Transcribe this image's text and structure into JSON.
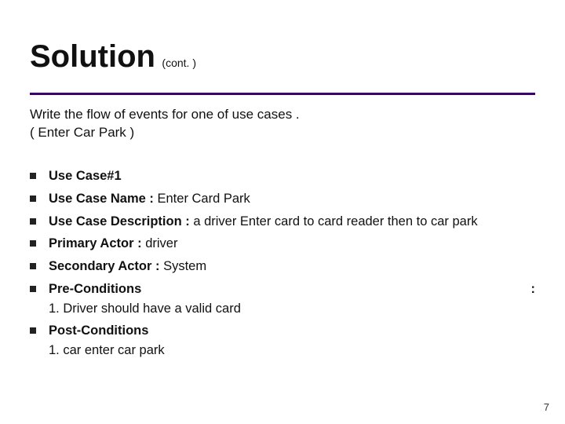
{
  "title": "Solution",
  "title_suffix": "(cont. )",
  "intro_line1": "Write the flow of events for one of use cases .",
  "intro_line2": "( Enter Car Park )",
  "items": {
    "i0": {
      "label": "Use Case#1",
      "value": ""
    },
    "i1": {
      "label": "Use Case Name : ",
      "value": "Enter Card Park"
    },
    "i2": {
      "label": "Use Case Description : ",
      "value": "a driver Enter card to card reader then to car park"
    },
    "i3": {
      "label": "Primary Actor : ",
      "value": "driver"
    },
    "i4": {
      "label": "Secondary Actor : ",
      "value": "System"
    },
    "i5": {
      "label": "Pre-Conditions",
      "colon": ":",
      "sub": "1. Driver should have a valid card"
    },
    "i6": {
      "label": "Post-Conditions",
      "sub": "1. car enter car park"
    }
  },
  "page_number": "7"
}
